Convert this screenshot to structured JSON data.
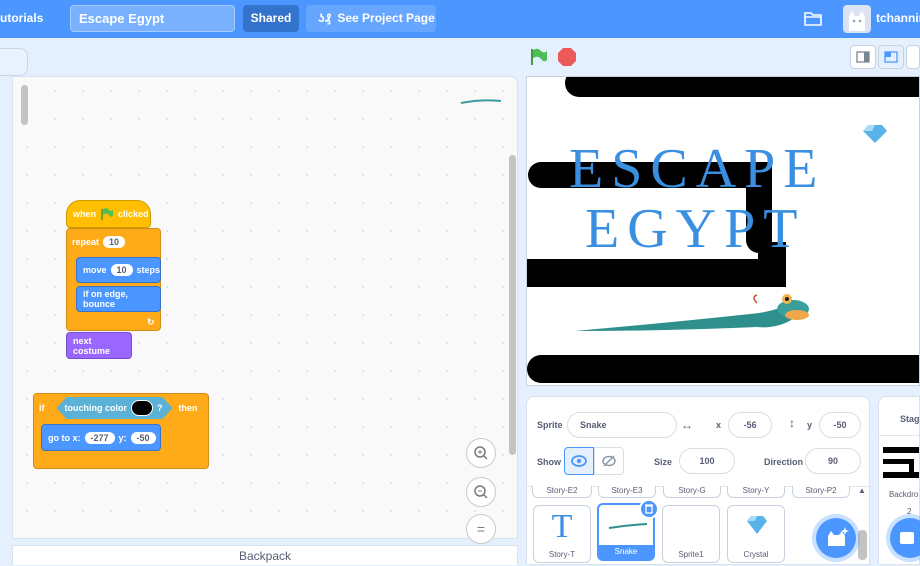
{
  "topbar": {
    "tutorials": "utorials",
    "project_title": "Escape Egypt",
    "shared_label": "Shared",
    "see_project_label": "See Project Page",
    "username": "tchannin",
    "folder_icon": "folder-icon"
  },
  "workspace": {
    "backpack_label": "Backpack",
    "blocks": {
      "when_label": "when",
      "clicked_label": "clicked",
      "repeat_label": "repeat",
      "repeat_count": "10",
      "move_label": "move",
      "move_steps": "10",
      "steps_label": "steps",
      "bounce_label": "if on edge, bounce",
      "next_costume_label": "next costume",
      "if_label": "if",
      "touching_color_label": "touching color",
      "question_mark": "?",
      "then_label": "then",
      "goto_label": "go to x:",
      "goto_x": "-277",
      "y_label": "y:",
      "goto_y": "-50"
    },
    "zoom_in": "+",
    "zoom_out": "−",
    "zoom_reset": "="
  },
  "stage": {
    "title_line1": "ESCAPE",
    "title_line2": "EGYPT"
  },
  "sprite_info": {
    "sprite_label": "Sprite",
    "sprite_name": "Snake",
    "x_label": "x",
    "x_value": "-56",
    "y_label": "y",
    "y_value": "-50",
    "show_label": "Show",
    "size_label": "Size",
    "size_value": "100",
    "direction_label": "Direction",
    "direction_value": "90"
  },
  "sprite_list": {
    "row_tabs": [
      "Story-E2",
      "Story-E3",
      "Story-G",
      "Story-Y",
      "Story-P2"
    ],
    "sprites": [
      {
        "name": "Story-T"
      },
      {
        "name": "Snake"
      },
      {
        "name": "Sprite1"
      },
      {
        "name": "Crystal"
      }
    ]
  },
  "stage_target": {
    "label": "Stage",
    "backdrops_label": "Backdro",
    "backdrops_count": "2"
  },
  "colors": {
    "topbar": "#4c97ff",
    "events": "#ffbf00",
    "control": "#ffab19",
    "motion": "#4c97ff",
    "looks": "#9966ff",
    "sensing": "#5cb1d6"
  }
}
